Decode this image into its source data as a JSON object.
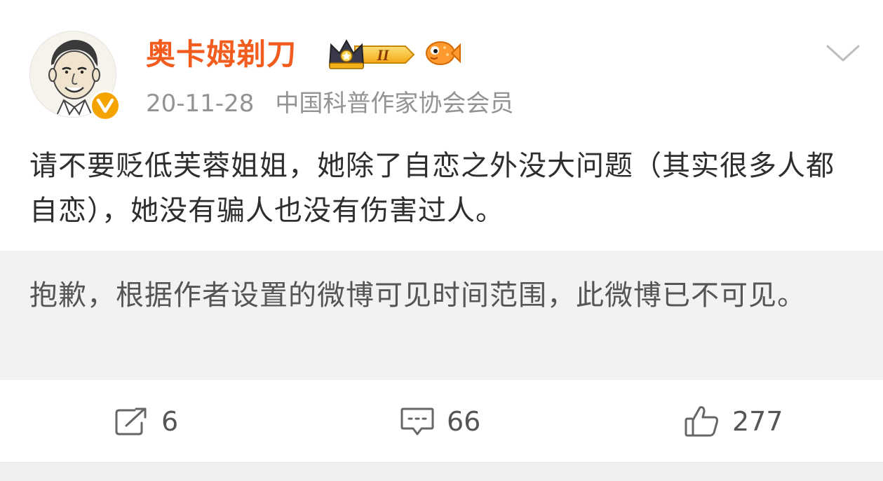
{
  "post": {
    "author": {
      "name": "奥卡姆剃刀",
      "avatar_icon": "avatar-caricature",
      "verified_icon": "verified-v-icon",
      "vip_level": "II",
      "badge_icons": [
        "crown-vip-icon",
        "fish-badge-icon"
      ],
      "name_color": "#f25d1f"
    },
    "date": "20-11-28",
    "description": "中国科普作家协会会员",
    "text": "请不要贬低芙蓉姐姐，她除了自恋之外没大问题（其实很多人都自恋），她没有骗人也没有伤害过人。",
    "notice": "抱歉，根据作者设置的微博可见时间范围，此微博已不可见。",
    "actions": {
      "repost_count": "6",
      "comment_count": "66",
      "like_count": "277",
      "repost_icon": "repost-icon",
      "comment_icon": "comment-icon",
      "like_icon": "thumbs-up-icon"
    },
    "menu_icon": "chevron-down-icon"
  }
}
